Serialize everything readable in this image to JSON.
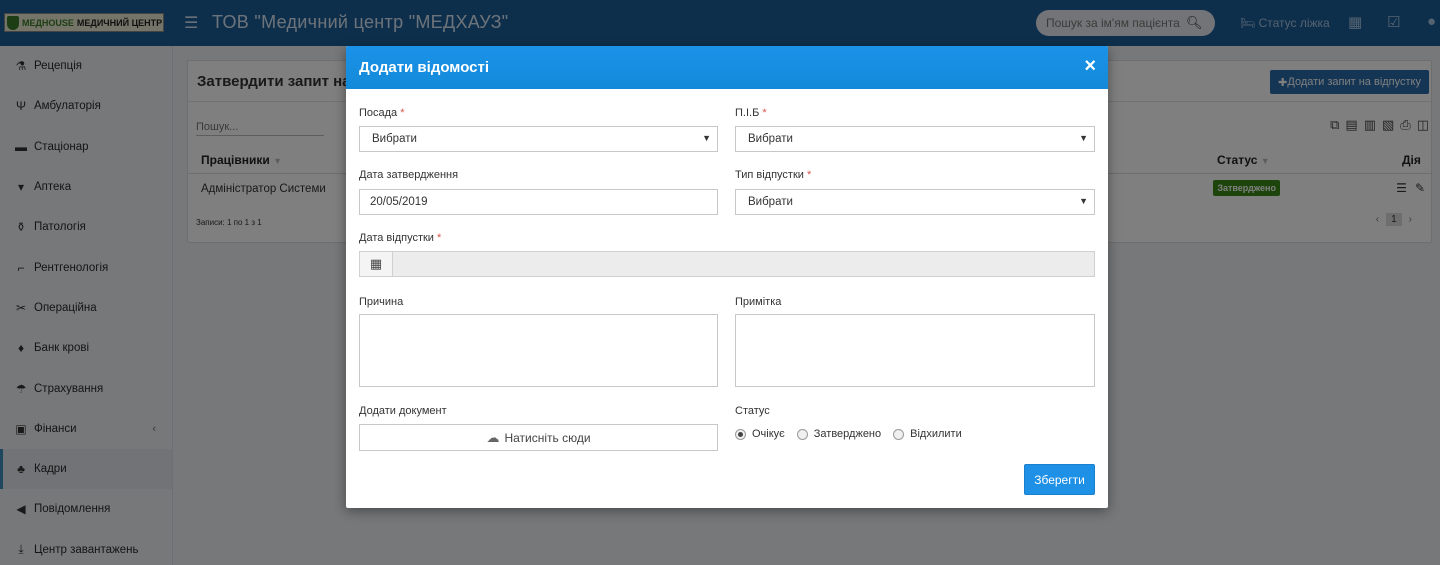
{
  "header": {
    "logo_part1": "МЕДHOUSE",
    "logo_part2": "МЕДИЧНИЙ ЦЕНТР",
    "title": "ТОВ \"Медичний центр \"МЕДХАУЗ\"",
    "search_placeholder": "Пошук за ім'ям пацієнта",
    "bed_status": "Статус ліжка"
  },
  "sidebar": {
    "items": [
      {
        "label": "Рецепція",
        "icon": "reception-icon"
      },
      {
        "label": "Амбулаторія",
        "icon": "stethoscope-icon"
      },
      {
        "label": "Стаціонар",
        "icon": "bed-icon"
      },
      {
        "label": "Аптека",
        "icon": "pharmacy-icon"
      },
      {
        "label": "Патологія",
        "icon": "flask-icon"
      },
      {
        "label": "Рентгенологія",
        "icon": "xray-icon"
      },
      {
        "label": "Операційна",
        "icon": "scissors-icon"
      },
      {
        "label": "Банк крові",
        "icon": "blood-drop-icon"
      },
      {
        "label": "Страхування",
        "icon": "umbrella-icon"
      },
      {
        "label": "Фінанси",
        "icon": "money-icon"
      },
      {
        "label": "Кадри",
        "icon": "org-chart-icon"
      },
      {
        "label": "Повідомлення",
        "icon": "megaphone-icon"
      },
      {
        "label": "Центр завантажень",
        "icon": "download-icon"
      }
    ],
    "active": "Кадри"
  },
  "page": {
    "title": "Затвердити запит на",
    "add_button": "Додати запит на відпустку",
    "search_placeholder": "Пошук...",
    "table": {
      "col_employees": "Працівники",
      "col_status": "Статус",
      "col_actions": "Дія",
      "row_name": "Адміністратор Системи",
      "row_status": "Затверджено"
    },
    "records": "Записи: 1 по 1 з 1",
    "page_number": "1"
  },
  "modal": {
    "title": "Додати відомості",
    "close": "×",
    "position_label": "Посада",
    "position_value": "Вибрати",
    "name_label": "П.І.Б",
    "name_value": "Вибрати",
    "approval_date_label": "Дата затвердження",
    "approval_date_value": "20/05/2019",
    "leave_type_label": "Тип відпустки",
    "leave_type_value": "Вибрати",
    "leave_date_label": "Дата відпустки",
    "reason_label": "Причина",
    "note_label": "Примітка",
    "add_document_label": "Додати документ",
    "upload_text": "Натисніть сюди",
    "status_label": "Статус",
    "status_options": [
      "Очікує",
      "Затверджено",
      "Відхилити"
    ],
    "status_selected": "Очікує",
    "save": "Зберегти",
    "required_mark": "*"
  }
}
